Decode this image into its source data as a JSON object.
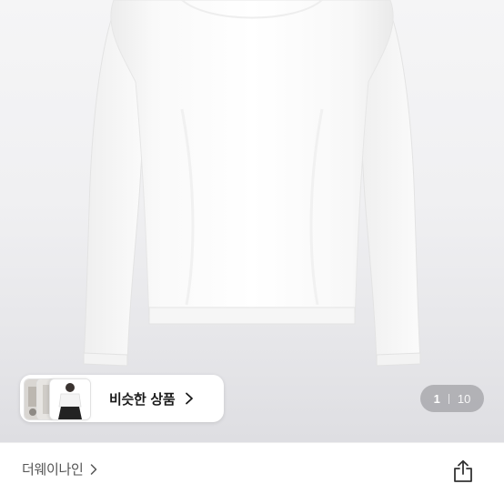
{
  "product_gallery": {
    "current_page": "1",
    "total_pages": "10",
    "photo_icon": "white-long-sleeve-top-photo"
  },
  "similar_products": {
    "label": "비슷한 상품",
    "chevron_icon": "chevron-right-icon"
  },
  "shop": {
    "name": "더웨이나인",
    "chevron_icon": "chevron-right-icon"
  },
  "share": {
    "icon": "share-icon"
  },
  "colors": {
    "indicator_bg": "#78787d",
    "text_dark": "#1a1a1a",
    "text_muted": "#555555"
  }
}
